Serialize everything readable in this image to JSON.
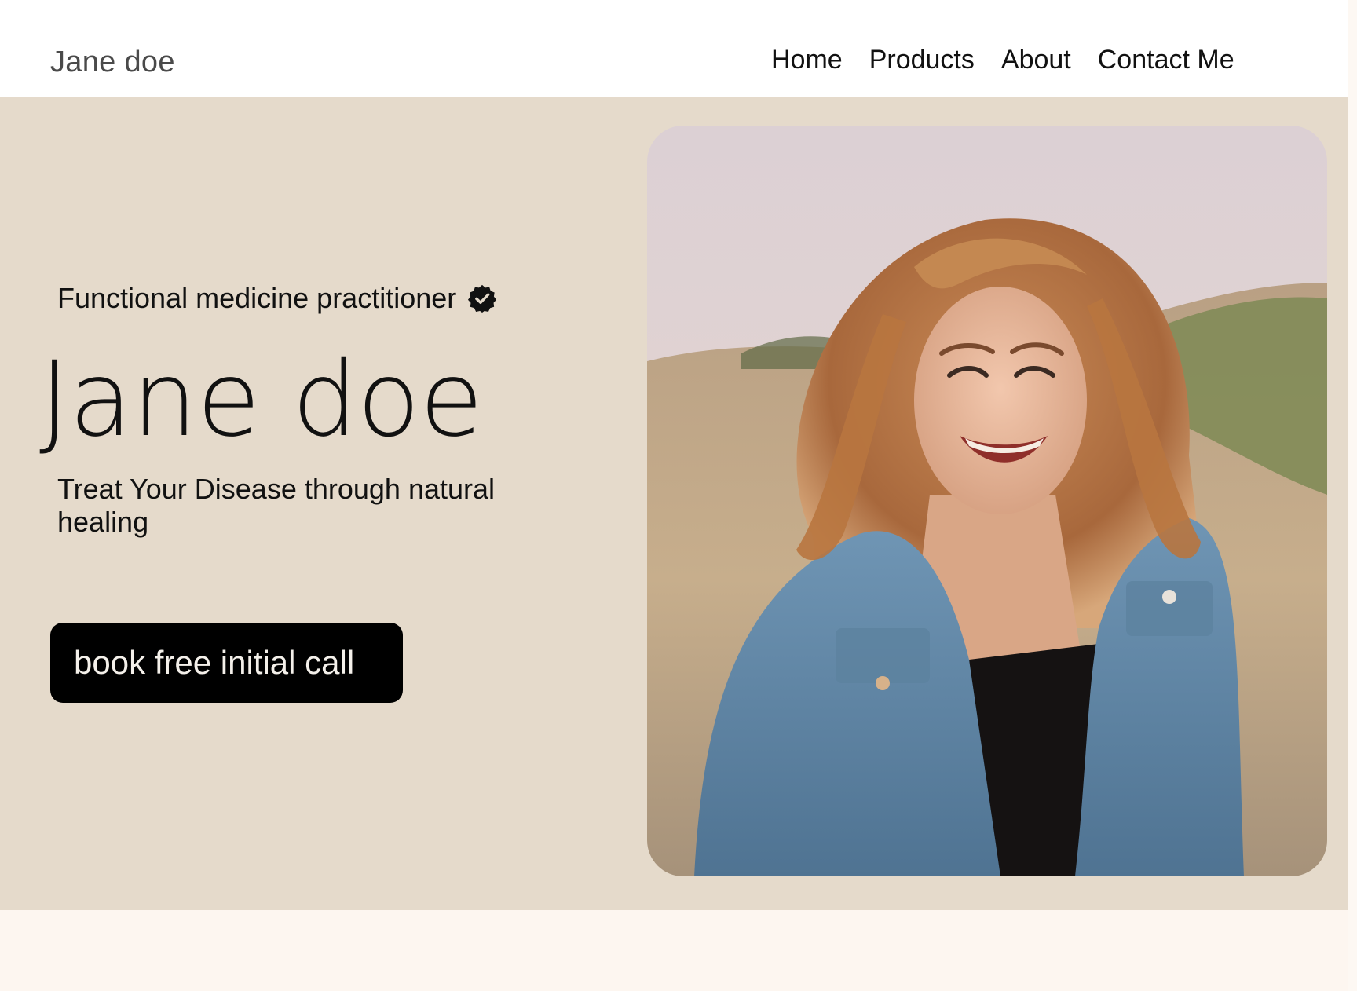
{
  "header": {
    "brand": "Jane doe",
    "nav": [
      {
        "label": "Home"
      },
      {
        "label": "Products"
      },
      {
        "label": "About"
      },
      {
        "label": "Contact Me"
      }
    ]
  },
  "hero": {
    "subtitle": "Functional medicine practitioner",
    "subtitle_icon": "verified-badge-icon",
    "title": "Jane doe",
    "tagline": "Treat Your Disease through natural healing",
    "cta_label": "book free initial call",
    "portrait_alt": "Smiling woman with wavy auburn hair in a denim jacket standing in a grassy field at sunset"
  },
  "colors": {
    "hero_background": "#e5dacb",
    "header_background": "#ffffff",
    "cta_background": "#000000",
    "cta_text": "#f4f0ea",
    "next_section_background": "#fdf6f0"
  }
}
